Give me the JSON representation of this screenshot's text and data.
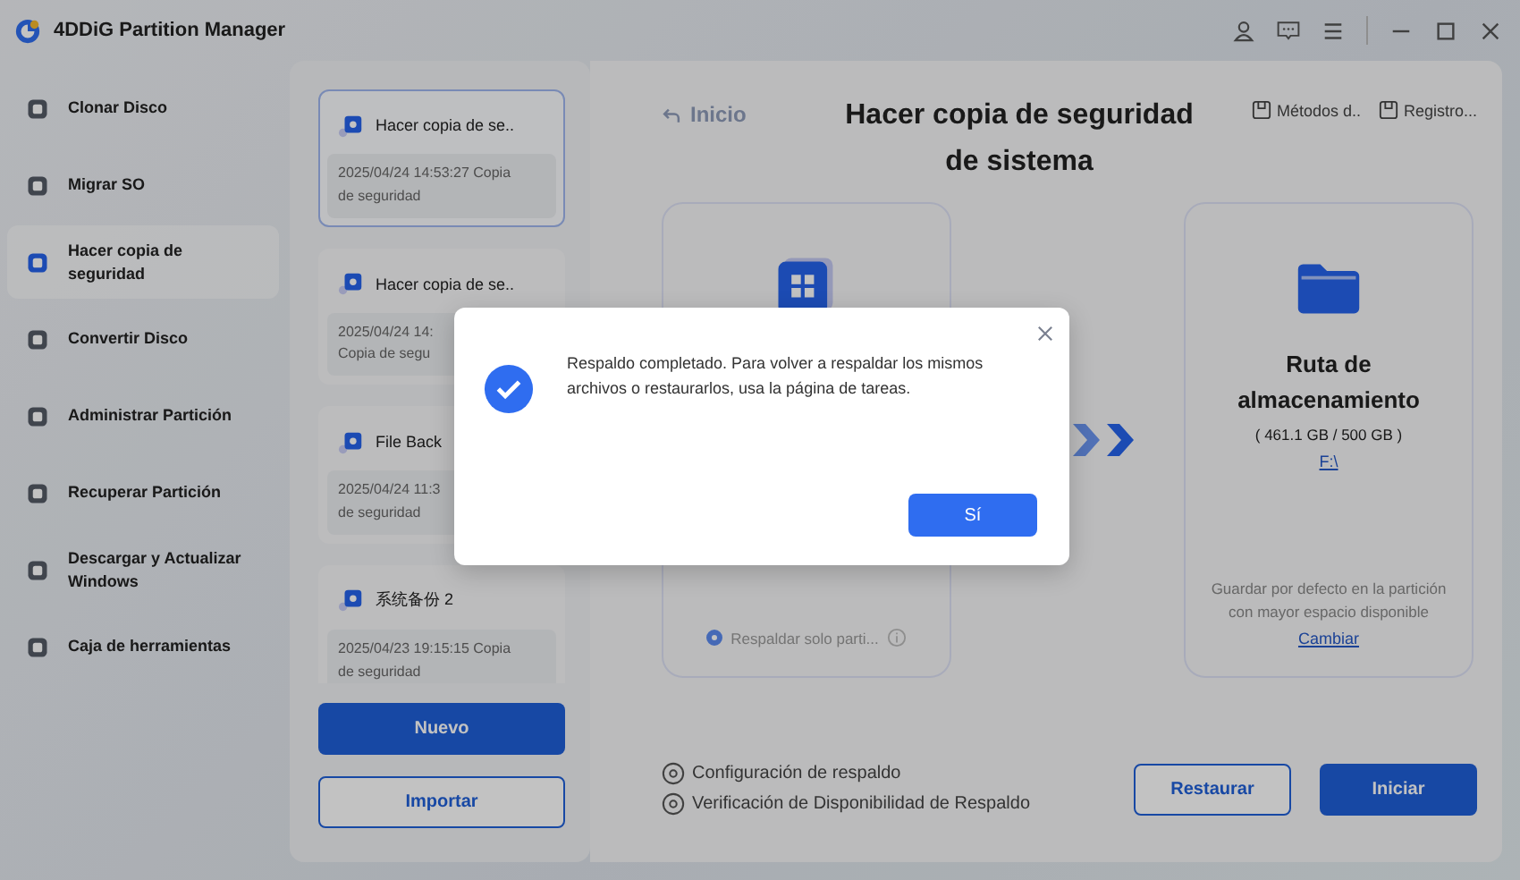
{
  "app": {
    "title": "4DDiG Partition Manager"
  },
  "sidebar": {
    "items": [
      {
        "label": "Clonar Disco",
        "selected": false
      },
      {
        "label": "Migrar SO",
        "selected": false
      },
      {
        "label": "Hacer copia de seguridad",
        "selected": true
      },
      {
        "label": "Convertir Disco",
        "selected": false
      },
      {
        "label": "Administrar Partición",
        "selected": false
      },
      {
        "label": "Recuperar Partición",
        "selected": false
      },
      {
        "label": "Descargar y Actualizar Windows",
        "selected": false
      },
      {
        "label": "Caja de herramientas",
        "selected": false
      }
    ]
  },
  "backups": {
    "items": [
      {
        "title": "Hacer copia de se..",
        "lines": [
          "2025/04/24 14:53:27 Copia",
          "de seguridad"
        ],
        "selected": true
      },
      {
        "title": "Hacer copia de se..",
        "lines": [
          "2025/04/24 14:",
          "Copia de segu"
        ],
        "selected": false
      },
      {
        "title": "File Back",
        "lines": [
          "2025/04/24 11:3",
          "de seguridad"
        ],
        "selected": false
      },
      {
        "title": "系统备份 2",
        "lines": [
          "2025/04/23 19:15:15 Copia",
          "de seguridad"
        ],
        "selected": false
      }
    ],
    "new_button": "Nuevo",
    "import_button": "Importar"
  },
  "main": {
    "back": {
      "label": "Inicio",
      "disabled": true
    },
    "title": "Hacer copia de seguridad de sistema",
    "links": [
      "Métodos d..",
      "Registro..."
    ],
    "source": {
      "option": {
        "label": "Respaldar solo parti...",
        "selected": true
      }
    },
    "target": {
      "title": "Ruta de almacenamiento",
      "capacity": "( 461.1 GB / 500 GB )",
      "drive": "F:\\",
      "note": "Guardar por defecto en la partición con mayor espacio disponible",
      "link": "Cambiar"
    },
    "footer_links": [
      "Configuración de respaldo",
      "Verificación de Disponibilidad de Respaldo"
    ],
    "buttons": [
      "Restaurar",
      "Iniciar"
    ]
  },
  "dialog": {
    "message": "Respaldo completado. Para volver a respaldar los mismos archivos o restaurarlos, usa la página de tareas.",
    "button": "Sí"
  }
}
